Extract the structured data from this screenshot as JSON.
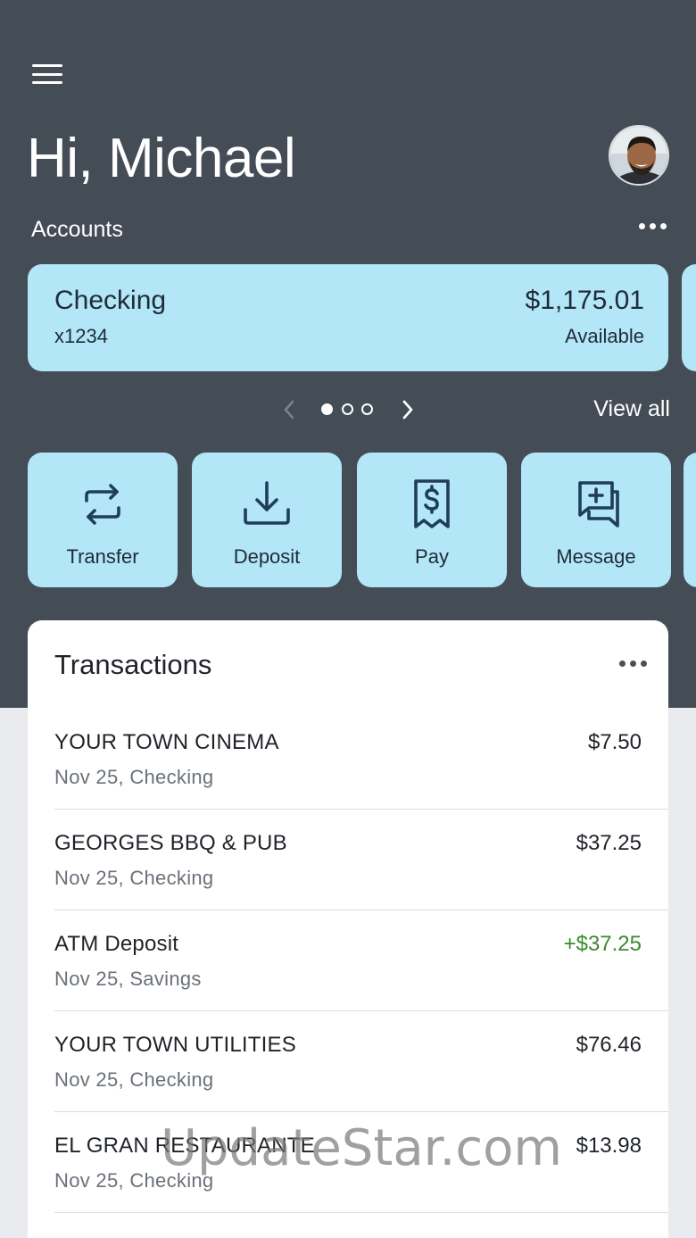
{
  "header": {
    "greeting": "Hi, Michael",
    "accounts_label": "Accounts",
    "view_all": "View all"
  },
  "account": {
    "name": "Checking",
    "number": "x1234",
    "balance": "$1,175.01",
    "balance_label": "Available"
  },
  "pager": {
    "total_pages": 3,
    "current_page": 1
  },
  "actions": [
    {
      "label": "Transfer",
      "icon": "transfer-icon"
    },
    {
      "label": "Deposit",
      "icon": "deposit-icon"
    },
    {
      "label": "Pay",
      "icon": "pay-bill-icon"
    },
    {
      "label": "Message",
      "icon": "message-icon"
    }
  ],
  "transactions": {
    "title": "Transactions",
    "items": [
      {
        "name": "YOUR TOWN CINEMA",
        "detail": "Nov 25, Checking",
        "amount": "$7.50",
        "credit": false
      },
      {
        "name": "GEORGES BBQ & PUB",
        "detail": "Nov 25, Checking",
        "amount": "$37.25",
        "credit": false
      },
      {
        "name": "ATM Deposit",
        "detail": "Nov 25, Savings",
        "amount": "+$37.25",
        "credit": true
      },
      {
        "name": "YOUR TOWN UTILITIES",
        "detail": "Nov 25, Checking",
        "amount": "$76.46",
        "credit": false
      },
      {
        "name": "EL GRAN RESTAURANTE",
        "detail": "Nov 25, Checking",
        "amount": "$13.98",
        "credit": false
      }
    ]
  },
  "watermark": "UpdateStar.com",
  "colors": {
    "header_bg": "#444c56",
    "card_bg": "#b3e6f7",
    "credit_green": "#3c8a2e",
    "icon_navy": "#1f3d5c"
  }
}
